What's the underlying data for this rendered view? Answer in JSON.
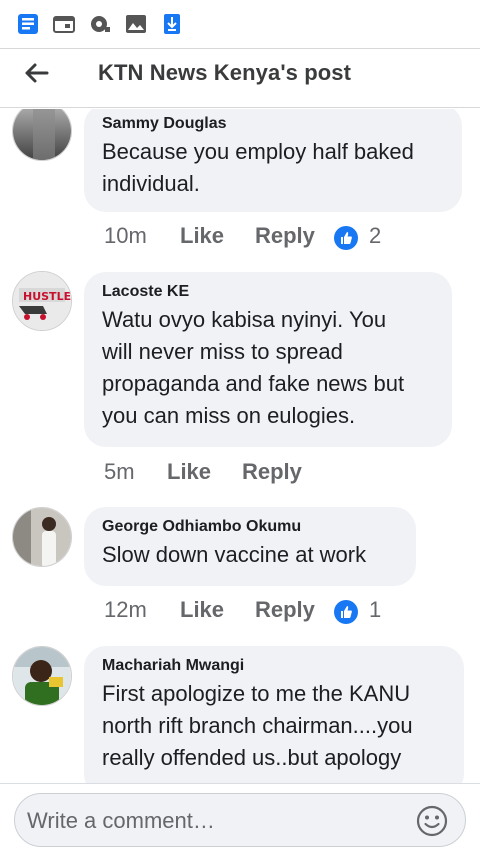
{
  "status_icons": [
    "facebook-lite-icon",
    "calendar-icon",
    "camera-feed-icon",
    "image-icon",
    "download-icon"
  ],
  "header": {
    "title": "KTN News Kenya's post"
  },
  "comments": [
    {
      "name": "Sammy Douglas",
      "text_lines": [
        "Because you employ half baked",
        "individual."
      ],
      "time": "10m",
      "like": "Like",
      "reply": "Reply",
      "reactions": "2",
      "avatar": "grey-gradient-avatar"
    },
    {
      "name": "Lacoste KE",
      "text_lines": [
        "Watu ovyo kabisa nyinyi. You",
        "will never miss to spread",
        "propaganda and fake news but",
        "you can miss on eulogies."
      ],
      "time": "5m",
      "like": "Like",
      "reply": "Reply",
      "reactions": "",
      "avatar": "hustler-logo-avatar"
    },
    {
      "name": "George Odhiambo Okumu",
      "text_lines": [
        "Slow down vaccine at work"
      ],
      "time": "12m",
      "like": "Like",
      "reply": "Reply",
      "reactions": "1",
      "avatar": "person-photo-avatar"
    },
    {
      "name": "Machariah Mwangi",
      "text_lines": [
        "First apologize to me the KANU",
        "north rift branch chairman....you",
        "really offended us..but apology"
      ],
      "time": "",
      "like": "",
      "reply": "",
      "reactions": "",
      "avatar": "man-photo-avatar"
    }
  ],
  "composer": {
    "placeholder": "Write a comment…"
  },
  "colors": {
    "accent": "#1877f2",
    "bubble": "#f0f2f5",
    "meta": "#65676b",
    "text": "#1c1e21"
  }
}
